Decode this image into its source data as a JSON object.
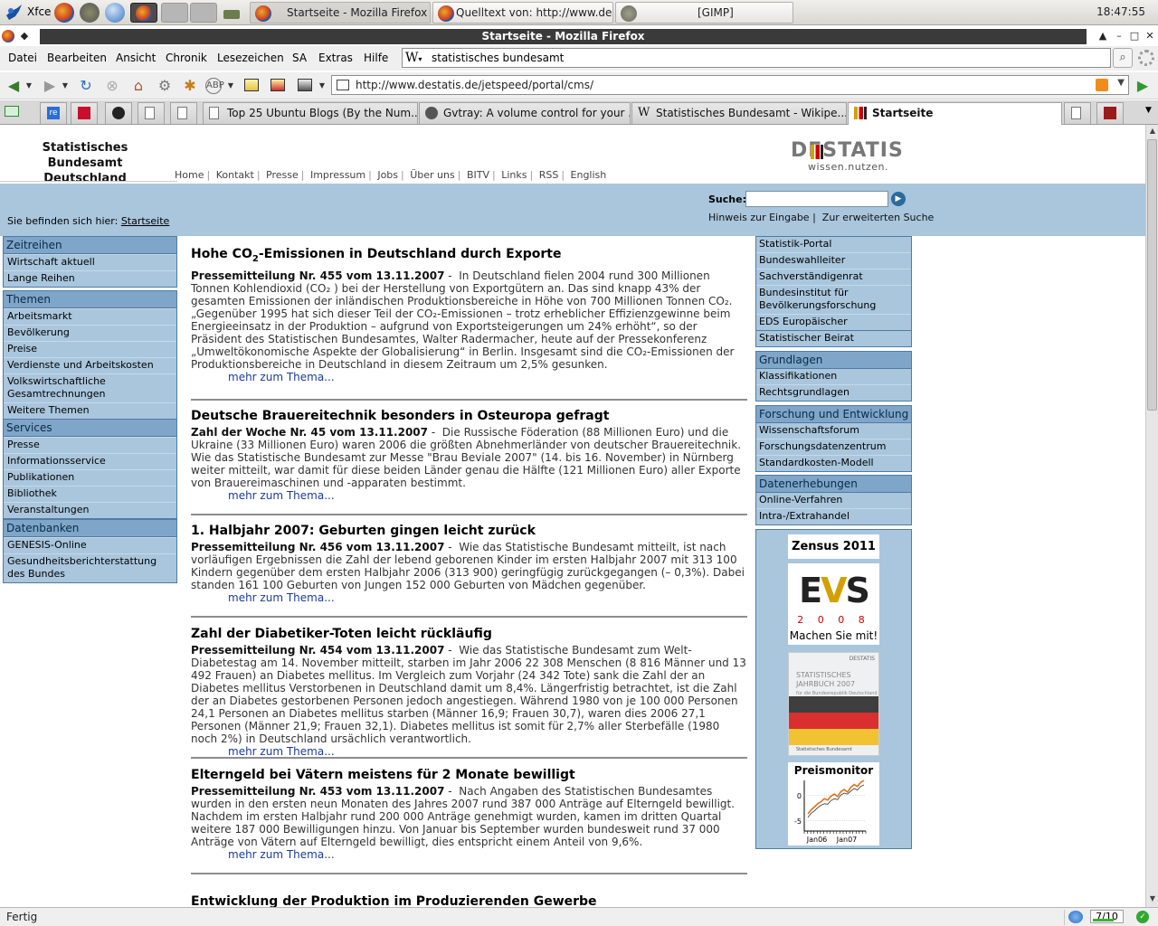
{
  "taskbar": {
    "start_label": "Xfce",
    "clock": "18:47:55",
    "windows": [
      {
        "label": "Startseite - Mozilla Firefox",
        "active": true
      },
      {
        "label": "Quelltext von: http://www.de...",
        "active": false
      },
      {
        "label": "[GIMP]",
        "active": false
      }
    ]
  },
  "window": {
    "title": "Startseite - Mozilla Firefox"
  },
  "menus": [
    "Datei",
    "Bearbeiten",
    "Ansicht",
    "Chronik",
    "Lesezeichen",
    "SA",
    "Extras",
    "Hilfe"
  ],
  "search": {
    "engine_label": "W",
    "value": "statistisches bundesamt"
  },
  "urlbar": {
    "value": "http://www.destatis.de/jetspeed/portal/cms/"
  },
  "tabs": [
    {
      "label": "Top 25 Ubuntu Blogs (By the Num...",
      "active": false
    },
    {
      "label": "Gvtray: A volume control for your ...",
      "active": false
    },
    {
      "label": "Statistisches Bundesamt - Wikipe...",
      "active": false
    },
    {
      "label": "Startseite",
      "active": true
    }
  ],
  "pinned_tabs": [
    "re"
  ],
  "site": {
    "title_line1": "Statistisches Bundesamt",
    "title_line2": "Deutschland",
    "logo_word": "DESTATIS",
    "logo_tag": "wissen.nutzen.",
    "topnav": [
      "Home",
      "Kontakt",
      "Presse",
      "Impressum",
      "Jobs",
      "Über uns",
      "BITV",
      "Links",
      "RSS",
      "English"
    ],
    "search_label": "Suche:",
    "search_hint_1": "Hinweis zur Eingabe",
    "search_hint_2": "Zur erweiterten Suche",
    "breadcrumb_prefix": "Sie befinden sich hier:",
    "breadcrumb_link": "Startseite"
  },
  "left_nav": [
    {
      "header": "Zeitreihen",
      "items": [
        "Wirtschaft aktuell",
        "Lange Reihen"
      ]
    },
    {
      "header": "Themen",
      "items": [
        "Arbeitsmarkt",
        "Bevölkerung",
        "Preise",
        "Verdienste und Arbeitskosten",
        "Volkswirtschaftliche Gesamtrechnungen",
        "Weitere Themen"
      ]
    },
    {
      "header": "Services",
      "items": [
        "Presse",
        "Informationsservice",
        "Publikationen",
        "Bibliothek",
        "Veranstaltungen"
      ]
    },
    {
      "header": "Datenbanken",
      "items": [
        "GENESIS-Online",
        "Gesundheitsberichterstattung des Bundes"
      ]
    }
  ],
  "right_nav": {
    "links_box": [
      "Statistik-Portal",
      "Bundeswahlleiter",
      "Sachverständigenrat",
      "Bundesinstitut für Bevölkerungsforschung",
      "EDS Europäischer Datenservice"
    ],
    "beirat": "Statistischer Beirat",
    "boxes": [
      {
        "header": "Grundlagen",
        "items": [
          "Klassifikationen",
          "Rechtsgrundlagen"
        ]
      },
      {
        "header": "Forschung und Entwicklung",
        "items": [
          "Wissenschaftsforum",
          "Forschungsdatenzentrum",
          "Standardkosten-Modell"
        ]
      },
      {
        "header": "Datenerhebungen",
        "items": [
          "Online-Verfahren",
          "Intra-/Extrahandel"
        ]
      }
    ]
  },
  "promo": {
    "zensus": "Zensus 2011",
    "evs_year": "2 0 0 8",
    "evs_cta": "Machen Sie mit!",
    "jahrbuch_logo": "DESTATIS",
    "jahrbuch_title_1": "STATISTISCHES",
    "jahrbuch_title_2": "JAHRBUCH 2007",
    "jahrbuch_sub": "für die Bundesrepublik Deutschland",
    "jahrbuch_foot": "Statistisches Bundesamt",
    "preis_title": "Preismonitor",
    "preis_chart": {
      "type": "line",
      "x_ticks": [
        "Jan06",
        "Jan07"
      ],
      "y_ticks": [
        0,
        -5
      ],
      "ylim": [
        -7,
        3
      ],
      "series": [
        {
          "values": [
            -3.6,
            -2.8,
            -2.2,
            -1.6,
            -1.2,
            -0.6,
            -0.9,
            -0.1,
            0.3,
            -0.2,
            0.8,
            1.2,
            0.7,
            1.6,
            2.2,
            1.8,
            2.6,
            3.0
          ]
        },
        {
          "values": [
            -4.3,
            -3.5,
            -3.0,
            -2.4,
            -1.9,
            -1.6,
            -1.7,
            -1.0,
            -0.6,
            -0.8,
            0.1,
            0.5,
            0.3,
            0.9,
            1.4,
            1.1,
            1.8,
            2.1
          ]
        }
      ],
      "colors": [
        "#e0701a",
        "#333333"
      ]
    }
  },
  "more_label": "mehr zum Thema...",
  "articles": [
    {
      "title_pre": "Hohe CO",
      "title_sub": "2",
      "title_post": "-Emissionen in Deutschland durch Exporte",
      "kicker": "Pressemitteilung Nr. 455 vom 13.11.2007",
      "body": "In Deutschland fielen 2004 rund 300 Millionen Tonnen Kohlendioxid (CO₂ ) bei der Herstellung von Exportgütern an. Das sind knapp 43% der gesamten Emissionen der inländischen Produktionsbereiche in Höhe von 700 Millionen Tonnen CO₂.",
      "body2": "„Gegenüber 1995 hat sich dieser Teil der CO₂-Emissionen – trotz erheblicher Effizienzgewinne beim Energieeinsatz in der Produktion – aufgrund von Exportsteigerungen um 24% erhöht“, so der Präsident des Statistischen Bundesamtes, Walter Radermacher, heute auf der Pressekonferenz „Umweltökonomische Aspekte der Globalisierung“ in Berlin. Insgesamt sind die CO₂-Emissionen der Produktionsbereiche in Deutschland in diesem Zeitraum um 2,5% gesunken."
    },
    {
      "title_pre": "Deutsche Brauereitechnik besonders in Osteuropa gefragt",
      "kicker": "Zahl der Woche Nr. 45 vom 13.11.2007",
      "body": "Die Russische Föderation (88 Millionen Euro) und die Ukraine (33 Millionen Euro) waren 2006 die größten Abnehmerländer von deutscher Brauereitechnik. Wie das Statistische Bundesamt zur Messe \"Brau Beviale 2007\" (14. bis 16. November) in Nürnberg weiter mitteilt, war damit für diese beiden Länder genau die Hälfte (121 Millionen Euro) aller Exporte von Brauereimaschinen und -apparaten bestimmt."
    },
    {
      "title_pre": "1. Halbjahr 2007: Geburten gingen leicht zurück",
      "kicker": "Pressemitteilung Nr. 456 vom 13.11.2007",
      "body": "Wie das Statistische Bundesamt mitteilt, ist nach vorläufigen Ergebnissen die Zahl der lebend geborenen Kinder im ersten Halbjahr 2007 mit 313 100 Kindern gegenüber dem ersten Halbjahr 2006 (313 900) geringfügig zurückgegangen (– 0,3%). Dabei standen 161 100 Geburten von Jungen 152 000 Geburten von Mädchen gegenüber."
    },
    {
      "title_pre": "Zahl der Diabetiker-Toten leicht rückläufig",
      "kicker": "Pressemitteilung Nr. 454 vom 13.11.2007",
      "body": "Wie das Statistische Bundesamt zum Welt-Diabetestag am 14. November mitteilt, starben im Jahr 2006  22 308 Menschen (8 816 Männer und 13 492 Frauen) an Diabetes mellitus. Im Vergleich zum Vorjahr (24 342 Tote) sank die Zahl der an Diabetes mellitus Verstorbenen in Deutschland damit um 8,4%. Längerfristig betrachtet, ist die Zahl der an Diabetes gestorbenen Personen jedoch angestiegen. Während 1980 von je 100 000 Personen 24,1 Personen an Diabetes mellitus starben (Männer 16,9; Frauen 30,7), waren dies 2006  27,1 Personen (Männer 21,9; Frauen 32,1). Diabetes mellitus ist somit für 2,7% aller Sterbefälle (1980 noch 2%) in Deutschland ursächlich verantwortlich."
    },
    {
      "title_pre": "Elterngeld bei Vätern meistens für 2 Monate bewilligt",
      "kicker": "Pressemitteilung Nr. 453 vom 13.11.2007",
      "body": "Nach Angaben des Statistischen Bundesamtes wurden in den ersten neun Monaten des Jahres 2007 rund 387 000 Anträge auf Elterngeld bewilligt. Nachdem im ersten Halbjahr rund 200 000 Anträge genehmigt wurden, kamen im dritten Quartal weitere 187 000 Bewilligungen hinzu. Von Januar bis September wurden bundesweit rund 37 000 Anträge von Vätern auf Elterngeld bewilligt, dies entspricht einem Anteil von 9,6%."
    },
    {
      "title_pre": "Entwicklung der Produktion im Produzierenden Gewerbe"
    }
  ],
  "status": {
    "text": "Fertig",
    "score": "7/10",
    "score_fraction": 0.7
  }
}
